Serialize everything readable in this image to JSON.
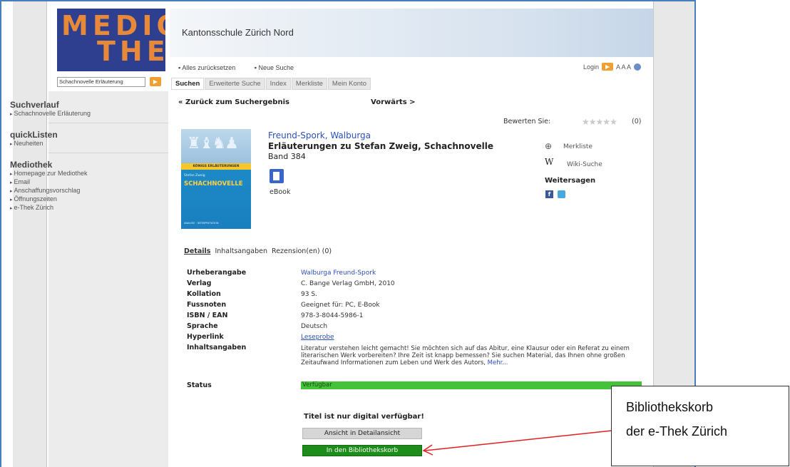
{
  "logo": {
    "line1": "MEDIO",
    "line2": "THEK"
  },
  "header": {
    "school": "Kantonsschule Zürich Nord"
  },
  "top_links": [
    "Alles zurücksetzen",
    "Neue Suche"
  ],
  "login": {
    "label": "Login",
    "text_size": "A A A"
  },
  "search": {
    "value": "Schachnovelle Erläuterung"
  },
  "tabs": [
    "Suchen",
    "Erweiterte Suche",
    "Index",
    "Merkliste",
    "Mein Konto"
  ],
  "sidebar": {
    "sections": [
      {
        "title": "Suchverlauf",
        "items": [
          "Schachnovelle Erläuterung"
        ]
      },
      {
        "title": "quickListen",
        "items": [
          "Neuheiten"
        ]
      },
      {
        "title": "Mediothek",
        "items": [
          "Homepage zur Mediothek",
          "Email",
          "Anschaffungsvorschlag",
          "Öffnungszeiten",
          "e-Thek Zürich"
        ]
      }
    ]
  },
  "nav": {
    "back": "« Zurück zum Suchergebnis",
    "forward": "Vorwärts >"
  },
  "rating": {
    "label": "Bewerten Sie:",
    "stars": 0,
    "count": "(0)"
  },
  "book": {
    "author": "Freund-Spork, Walburga",
    "title": "Erläuterungen zu Stefan Zweig, Schachnovelle",
    "band": "Band 384",
    "media": "eBook",
    "cover_band": "KÖNIGS ERLÄUTERUNGEN",
    "cover_author": "Stefan Zweig",
    "cover_title": "SCHACHNOVELLE",
    "cover_foot": "ANALYSE · INTERPRETATION"
  },
  "actions": {
    "merkliste": "Merkliste",
    "wiki": "Wiki-Suche",
    "weitersagen": "Weitersagen",
    "fb": "f"
  },
  "detail_tabs": [
    "Details",
    "Inhaltsangaben",
    "Rezension(en) (0)"
  ],
  "details": {
    "urheber_label": "Urheberangabe",
    "urheber": "Walburga Freund-Spork",
    "verlag_label": "Verlag",
    "verlag": "C. Bange Verlag GmbH, 2010",
    "kollation_label": "Kollation",
    "kollation": "93 S.",
    "fussnoten_label": "Fussnoten",
    "fussnoten": "Geeignet für: PC, E-Book",
    "isbn_label": "ISBN / EAN",
    "isbn": "978-3-8044-5986-1",
    "sprache_label": "Sprache",
    "sprache": "Deutsch",
    "hyperlink_label": "Hyperlink",
    "hyperlink": "Leseprobe",
    "inhalt_label": "Inhaltsangaben",
    "inhalt": "Literatur verstehen leicht gemacht! Sie möchten sich auf das Abitur, eine Klausur oder ein Referat zu einem literarischen Werk vorbereiten? Ihre Zeit ist knapp bemessen? Sie suchen Material, das Ihnen ohne großen Zeitaufwand Informationen zum Leben und Werk des Autors,",
    "inhalt_more": "Mehr...",
    "status_label": "Status",
    "status": "Verfügbar"
  },
  "digital_note": "Titel ist nur digital verfügbar!",
  "buttons": {
    "detail": "Ansicht in Detailansicht",
    "korb": "In den Bibliothekskorb"
  },
  "callout": {
    "line1": "Bibliothekskorb",
    "line2": "der e-Thek Zürich"
  },
  "colors": {
    "status_green": "#44c23a",
    "korb_green": "#1e8c1a",
    "accent_orange": "#f0a030",
    "link_blue": "#2a4fc0"
  }
}
